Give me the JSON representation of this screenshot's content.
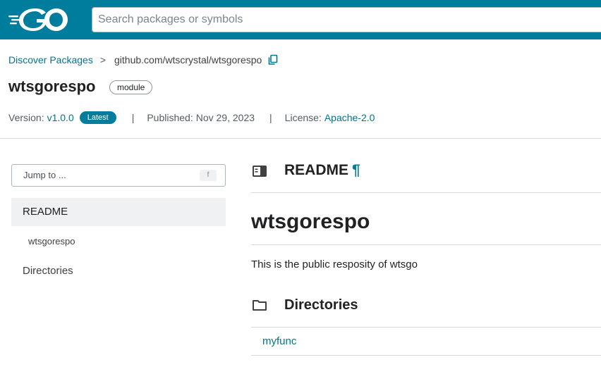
{
  "header": {
    "logo_name": "go-logo",
    "search_placeholder": "Search packages or symbols"
  },
  "breadcrumb": {
    "root": "Discover Packages",
    "separator": ">",
    "current": "github.com/wtscrystal/wtsgorespo"
  },
  "package": {
    "name": "wtsgorespo",
    "kind_badge": "module",
    "version_label": "Version:",
    "version": "v1.0.0",
    "latest_badge": "Latest",
    "published_label": "Published:",
    "published_date": "Nov 29, 2023",
    "license_label": "License:",
    "license": "Apache-2.0",
    "pipe": "|"
  },
  "sidebar": {
    "jump_placeholder": "Jump to ...",
    "jump_shortcut": "f",
    "items": [
      {
        "label": "README",
        "selected": true
      },
      {
        "label": "wtsgorespo",
        "indent": true
      },
      {
        "label": "Directories"
      }
    ]
  },
  "main": {
    "readme_heading": "README",
    "pilcrow": "¶",
    "readme_title": "wtsgorespo",
    "readme_text": "This is the public resposity of wtsgo",
    "directories_heading": "Directories",
    "directories": [
      "myfunc"
    ]
  },
  "colors": {
    "brand": "#007d9c",
    "link": "#00758f",
    "selected_bg": "#f0f1f2"
  }
}
